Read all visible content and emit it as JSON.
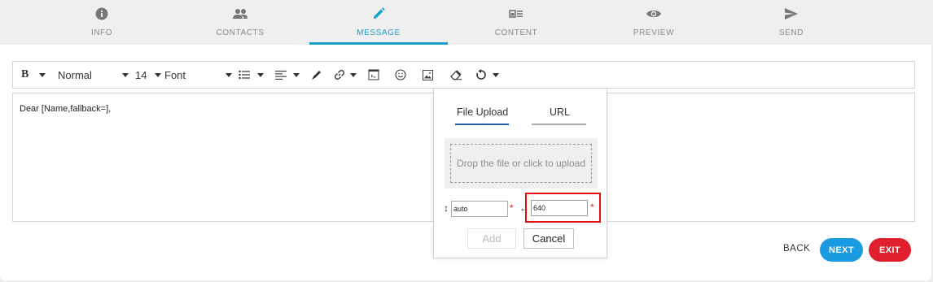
{
  "stepper": {
    "steps": [
      {
        "label": "INFO",
        "icon": "info-icon"
      },
      {
        "label": "CONTACTS",
        "icon": "people-icon"
      },
      {
        "label": "MESSAGE",
        "icon": "pencil-icon",
        "active": true
      },
      {
        "label": "CONTENT",
        "icon": "content-icon"
      },
      {
        "label": "PREVIEW",
        "icon": "eye-icon"
      },
      {
        "label": "SEND",
        "icon": "send-icon"
      }
    ],
    "active_color": "#17a2c8"
  },
  "toolbar": {
    "bold_label": "B",
    "style_value": "Normal",
    "size_value": "14",
    "font_value": "Font"
  },
  "editor": {
    "content": "Dear [Name,fallback=],"
  },
  "image_popup": {
    "tabs": [
      {
        "label": "File Upload",
        "active": true
      },
      {
        "label": "URL",
        "active": false
      }
    ],
    "dropzone_text": "Drop the file or click to upload",
    "height_value": "auto",
    "width_value": "640",
    "required_mark": "*",
    "add_label": "Add",
    "cancel_label": "Cancel"
  },
  "footer": {
    "back_label": "BACK",
    "next_label": "NEXT",
    "exit_label": "EXIT",
    "next_color": "#1a9be0",
    "exit_color": "#e0202f"
  }
}
